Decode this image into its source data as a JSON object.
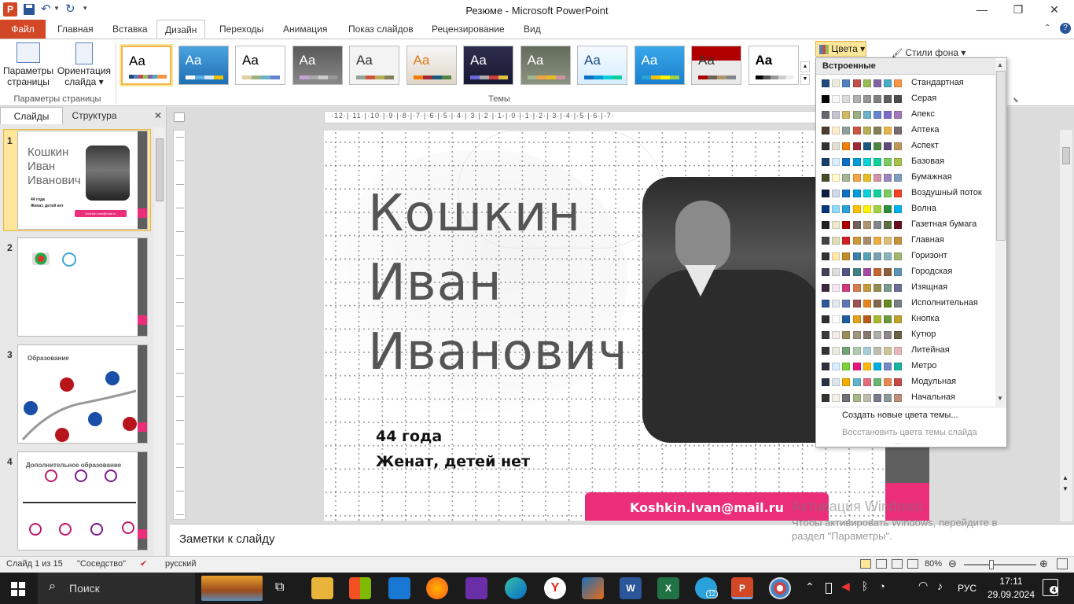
{
  "app": {
    "title": "Резюме  -  Microsoft PowerPoint",
    "logo": "P"
  },
  "tabs": [
    {
      "label": "Файл"
    },
    {
      "label": "Главная"
    },
    {
      "label": "Вставка"
    },
    {
      "label": "Дизайн"
    },
    {
      "label": "Переходы"
    },
    {
      "label": "Анимация"
    },
    {
      "label": "Показ слайдов"
    },
    {
      "label": "Рецензирование"
    },
    {
      "label": "Вид"
    }
  ],
  "ribbon": {
    "page_setup": {
      "params_line1": "Параметры",
      "params_line2": "страницы",
      "orient_line1": "Ориентация",
      "orient_line2": "слайда",
      "group_label": "Параметры страницы"
    },
    "themes_label": "Темы",
    "theme_text": "Aa",
    "colors_btn": "Цвета",
    "bg_styles_btn": "Стили фона"
  },
  "sidebar": {
    "tab_slides": "Слайды",
    "tab_outline": "Структура",
    "thumb1": {
      "name": "Кошкин\nИван\nИванович",
      "age": "44 года",
      "fam": "Женат, детей нет",
      "email": "Koshkin.Ivan@mail.ru"
    },
    "thumb3_title": "Образование",
    "thumb4_title": "Дополнительное образование",
    "nums": [
      "1",
      "2",
      "3",
      "4"
    ]
  },
  "slide": {
    "line1": "Кошкин",
    "line2": "Иван",
    "line3": "Иванович",
    "age": "44 года",
    "family": "Женат, детей нет",
    "email": "Koshkin.Ivan@mail.ru"
  },
  "ruler_text": "·12·|·11·|·10·|·9·|·8·|·7·|·6·|·5·|·4·|·3·|·2·|·1·|·0·|·1·|·2·|·3·|·4·|·5·|·6·|·7·",
  "dropdown": {
    "header": "Встроенные",
    "schemes": [
      {
        "name": "Стандартная",
        "colors": [
          "#1f497d",
          "#eeece1",
          "#4f81bd",
          "#c0504d",
          "#9bbb59",
          "#8064a2",
          "#4bacc6",
          "#f79646"
        ]
      },
      {
        "name": "Серая",
        "colors": [
          "#000000",
          "#f8f8f8",
          "#dddddd",
          "#b2b2b2",
          "#969696",
          "#808080",
          "#5f5f5f",
          "#4d4d4d"
        ]
      },
      {
        "name": "Апекс",
        "colors": [
          "#69676d",
          "#c9c2d1",
          "#ceb966",
          "#9cb084",
          "#6bb1c9",
          "#6585cf",
          "#7e6bc9",
          "#a379bb"
        ]
      },
      {
        "name": "Аптека",
        "colors": [
          "#4e3b30",
          "#fbeec9",
          "#93a299",
          "#cf543f",
          "#b5ae53",
          "#848058",
          "#e8b54d",
          "#786c71"
        ]
      },
      {
        "name": "Аспект",
        "colors": [
          "#323232",
          "#e3ded1",
          "#f07f09",
          "#9f2936",
          "#1b587c",
          "#4e8542",
          "#604878",
          "#c19859"
        ]
      },
      {
        "name": "Базовая",
        "colors": [
          "#17406d",
          "#dbefff",
          "#0f6fc6",
          "#009dd9",
          "#0bd0d9",
          "#10cf9b",
          "#7cca62",
          "#a5c249"
        ]
      },
      {
        "name": "Бумажная",
        "colors": [
          "#444d26",
          "#fefac9",
          "#a5b592",
          "#f3a447",
          "#e7bc29",
          "#d092a7",
          "#9c85c0",
          "#809ec2"
        ]
      },
      {
        "name": "Воздушный поток",
        "colors": [
          "#0f1d45",
          "#d0d9e8",
          "#0f6fc6",
          "#009dd9",
          "#0bd0d9",
          "#10cf9b",
          "#7cca62",
          "#f14124"
        ]
      },
      {
        "name": "Волна",
        "colors": [
          "#073779",
          "#8fd9fb",
          "#2ba3d9",
          "#ffc000",
          "#fff200",
          "#a1d146",
          "#2d8c3e",
          "#00b0f0"
        ]
      },
      {
        "name": "Газетная бумага",
        "colors": [
          "#222222",
          "#efeacc",
          "#ad0101",
          "#726056",
          "#ac956e",
          "#808689",
          "#5f6d42",
          "#6b0f1a"
        ]
      },
      {
        "name": "Главная",
        "colors": [
          "#434342",
          "#dfdcb7",
          "#d12020",
          "#cb9b38",
          "#a98b6d",
          "#ebad44",
          "#ddbd7c",
          "#c4923c"
        ]
      },
      {
        "name": "Горизонт",
        "colors": [
          "#333333",
          "#ffe8a8",
          "#c48b2a",
          "#3a80a8",
          "#56a2b7",
          "#79a3b0",
          "#8cb4b8",
          "#a1b86e"
        ]
      },
      {
        "name": "Городская",
        "colors": [
          "#424456",
          "#dedede",
          "#53548a",
          "#438086",
          "#a04da3",
          "#c4652d",
          "#8b5d3d",
          "#5c92b5"
        ]
      },
      {
        "name": "Изящная",
        "colors": [
          "#3d2b3d",
          "#fbe7f3",
          "#ce3b7d",
          "#d97d4e",
          "#c69a3b",
          "#918d51",
          "#7c9a8b",
          "#6c6e95"
        ]
      },
      {
        "name": "Исполнительная",
        "colors": [
          "#2f5897",
          "#e4e9ef",
          "#6076b4",
          "#9c5252",
          "#e68422",
          "#846648",
          "#63891f",
          "#758085"
        ]
      },
      {
        "name": "Кнопка",
        "colors": [
          "#303030",
          "#ffffff",
          "#1e5e9f",
          "#e3a21a",
          "#b55a1c",
          "#a8b82f",
          "#6e9a3a",
          "#c0a22c"
        ]
      },
      {
        "name": "Кутюр",
        "colors": [
          "#3b3b3b",
          "#f0eee7",
          "#9e8e5c",
          "#a09781",
          "#85776d",
          "#aeafa9",
          "#8d878b",
          "#6b6149"
        ]
      },
      {
        "name": "Литейная",
        "colors": [
          "#323232",
          "#eaebde",
          "#72a376",
          "#b0ccb0",
          "#a8cdd7",
          "#c0beaf",
          "#cec597",
          "#e8b7b7"
        ]
      },
      {
        "name": "Метро",
        "colors": [
          "#2c2f3b",
          "#d6ecff",
          "#7fd13b",
          "#ea157a",
          "#feb80a",
          "#00addc",
          "#738ac8",
          "#1ab39f"
        ]
      },
      {
        "name": "Модульная",
        "colors": [
          "#2a3241",
          "#dde6f0",
          "#f0ad00",
          "#60b5cc",
          "#e66c7d",
          "#6bb76d",
          "#e88651",
          "#c64847"
        ]
      },
      {
        "name": "Начальная",
        "colors": [
          "#343430",
          "#f5f0e6",
          "#6f6f74",
          "#a7b789",
          "#bebcab",
          "#7a7c8e",
          "#8c9b9a",
          "#c08d7b"
        ]
      }
    ],
    "create_new": "Создать новые цвета темы...",
    "restore": "Восстановить цвета темы слайда"
  },
  "notes_placeholder": "Заметки к слайду",
  "watermark": {
    "line1": "Активация Windows",
    "line2": "Чтобы активировать Windows, перейдите в",
    "line3": "раздел \"Параметры\"."
  },
  "status": {
    "slide": "Слайд 1 из 15",
    "theme": "\"Соседство\"",
    "lang": "русский",
    "zoom": "80%"
  },
  "taskbar": {
    "search": "Поиск",
    "lang": "РУС",
    "time": "17:11",
    "date": "29.09.2024",
    "notif": "4",
    "telegram_badge": "12"
  }
}
